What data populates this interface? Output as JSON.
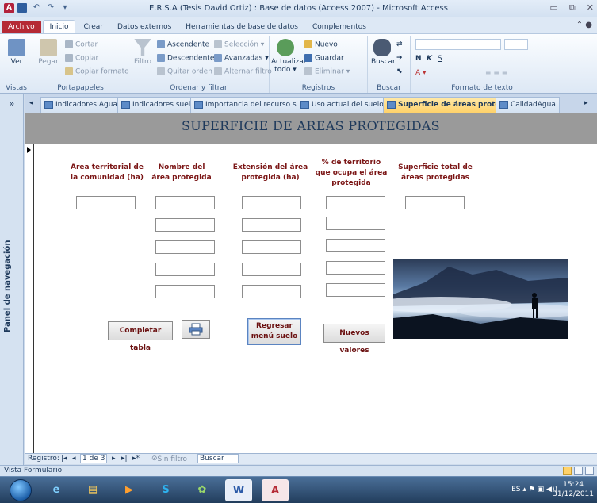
{
  "window": {
    "title": "E.R.S.A (Tesis David Ortiz) : Base de datos (Access 2007)  -  Microsoft Access",
    "app_icon_letter": "A"
  },
  "ribbon_tabs": [
    "Archivo",
    "Inicio",
    "Crear",
    "Datos externos",
    "Herramientas de base de datos",
    "Complementos"
  ],
  "ribbon": {
    "vistas": {
      "view_label": "Ver",
      "group": "Vistas"
    },
    "portapapeles": {
      "paste": "Pegar",
      "cut": "Cortar",
      "copy": "Copiar",
      "format_painter": "Copiar formato",
      "group": "Portapapeles"
    },
    "ordenar": {
      "filter": "Filtro",
      "asc": "Ascendente",
      "desc": "Descendente",
      "remove_sort": "Quitar orden",
      "selection": "Selección",
      "advanced": "Avanzadas",
      "toggle_filter": "Alternar filtro",
      "group": "Ordenar y filtrar"
    },
    "registros": {
      "refresh": "Actualizar",
      "refresh_all": "todo",
      "new": "Nuevo",
      "save": "Guardar",
      "delete": "Eliminar",
      "group": "Registros"
    },
    "buscar": {
      "find": "Buscar",
      "group": "Buscar"
    },
    "formato": {
      "group": "Formato de texto"
    }
  },
  "nav_pane": {
    "label": "Panel de navegación",
    "toggle": "»"
  },
  "doc_tabs": [
    {
      "label": "Indicadores Agua",
      "active": false
    },
    {
      "label": "Indicadores suelo",
      "active": false
    },
    {
      "label": "Importancia del recurso suelo",
      "active": false
    },
    {
      "label": "Uso actual del suelo",
      "active": false
    },
    {
      "label": "Superficie de áreas protegidas",
      "active": true
    },
    {
      "label": "CalidadAgua",
      "active": false
    }
  ],
  "form": {
    "title": "SUPERFICIE DE AREAS PROTEGIDAS",
    "columns": [
      "Area territorial de la comunidad (ha)",
      "Nombre del área protegida",
      "Extensión del área protegida (ha)",
      "% de territorio que ocupa el área protegida",
      "Superficie total de áreas protegidas"
    ],
    "buttons": {
      "complete": "Completar tabla",
      "back": "Regresar menú suelo",
      "new_values": "Nuevos valores"
    }
  },
  "record_nav": {
    "label": "Registro:",
    "current": "1 de 3",
    "filter": "Sin filtro",
    "search": "Buscar"
  },
  "status": {
    "view": "Vista Formulario"
  },
  "taskbar": {
    "lang": "ES",
    "time": "15:24",
    "date": "31/12/2011"
  }
}
